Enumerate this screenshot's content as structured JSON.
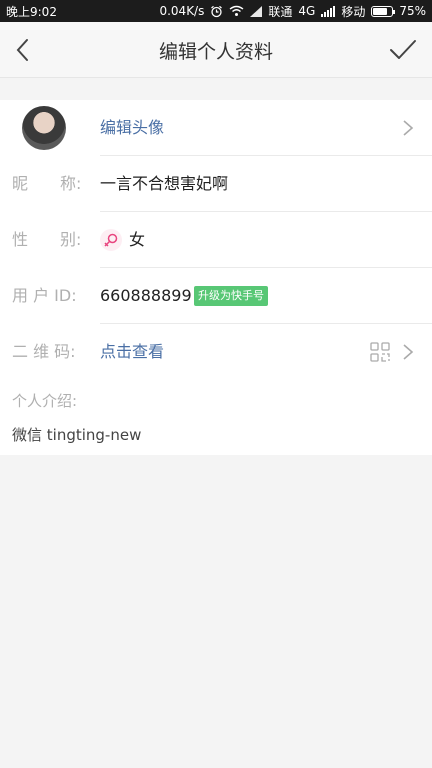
{
  "status_bar": {
    "time": "晚上9:02",
    "speed": "0.04K/s",
    "carrier1_name": "联通",
    "carrier1_net": "4G",
    "carrier2_name": "移动",
    "battery": "75%",
    "battery_level": 0.75
  },
  "header": {
    "title": "编辑个人资料",
    "back_icon": "chevron-left-icon",
    "confirm_icon": "checkmark-icon"
  },
  "profile": {
    "edit_avatar_label": "编辑头像",
    "nickname_label": "昵　　称:",
    "nickname_value": "一言不合想害妃啊",
    "gender_label": "性　　别:",
    "gender_value": "女",
    "userid_label": "用 户 ID:",
    "userid_value": "660888899",
    "upgrade_badge": "升级为快手号",
    "qrcode_label": "二 维 码:",
    "qrcode_value": "点击查看",
    "intro_label": "个人介绍:",
    "intro_value": "微信 tingting-new"
  },
  "colors": {
    "badge_green": "#58c775",
    "link_blue": "#4a6fa5",
    "female_pink": "#e8457f"
  }
}
